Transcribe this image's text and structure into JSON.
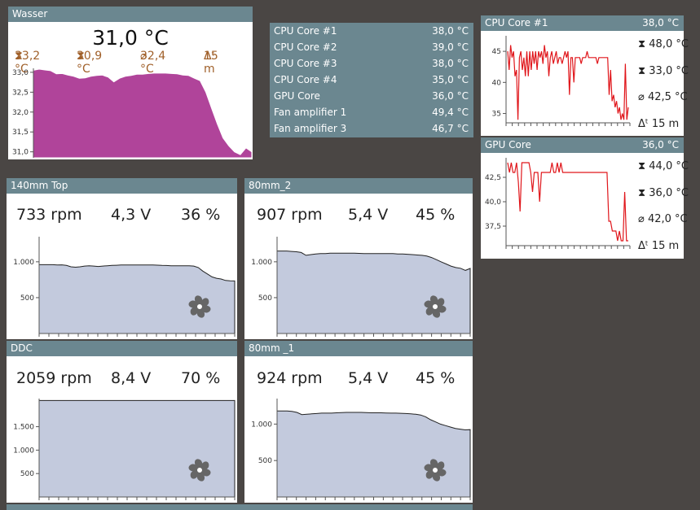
{
  "colors": {
    "header_bg": "#6b8790",
    "water_fill": "#b0449a",
    "fan_fill": "#c3cadd",
    "cpu_line": "#e0161b",
    "stats_accent": "#a0602a"
  },
  "water": {
    "title": "Wasser",
    "value": "31,0 °C",
    "max": "33,2 °C",
    "min": "30,9 °C",
    "avg": "32,4 °C",
    "span": "15 m",
    "y_ticks": [
      "33,0",
      "32,5",
      "32,0",
      "31,5",
      "31,0"
    ],
    "series": [
      33.05,
      33.08,
      33.06,
      33.04,
      32.96,
      32.97,
      32.93,
      32.9,
      32.85,
      32.86,
      32.9,
      32.92,
      32.93,
      32.88,
      32.76,
      32.85,
      32.9,
      32.92,
      32.95,
      32.95,
      32.97,
      32.98,
      32.98,
      32.98,
      32.97,
      32.96,
      32.93,
      32.92,
      32.85,
      32.79,
      32.5,
      32.1,
      31.7,
      31.35,
      31.15,
      31.0,
      30.93,
      31.1,
      31.0
    ]
  },
  "sensors": [
    {
      "name": "CPU Core #1",
      "value": "38,0 °C"
    },
    {
      "name": "CPU Core #2",
      "value": "39,0 °C"
    },
    {
      "name": "CPU Core #3",
      "value": "38,0 °C"
    },
    {
      "name": "CPU Core #4",
      "value": "35,0 °C"
    },
    {
      "name": "GPU Core",
      "value": "36,0 °C"
    },
    {
      "name": "Fan amplifier 1",
      "value": "49,4 °C"
    },
    {
      "name": "Fan amplifier 3",
      "value": "46,7 °C"
    }
  ],
  "cpu_core1": {
    "title": "CPU Core #1",
    "current": "38,0 °C",
    "max": "48,0 °C",
    "min": "33,0 °C",
    "avg": "42,5 °C",
    "span": "15 m",
    "y_ticks": [
      "45",
      "40",
      "35"
    ],
    "series": [
      45,
      42,
      46,
      44,
      45,
      41,
      42,
      34,
      44,
      45,
      42,
      44,
      41,
      45,
      41,
      45,
      42,
      45,
      43,
      45,
      42,
      45,
      44,
      45,
      43,
      46,
      44,
      45,
      41,
      44,
      45,
      43,
      44,
      45,
      43,
      44,
      44,
      43,
      44,
      45,
      44,
      45,
      38,
      44,
      44,
      40,
      44,
      44,
      44,
      44,
      43,
      44,
      44,
      44,
      45,
      44,
      44,
      44,
      44,
      44,
      44,
      43,
      44,
      44,
      44,
      44,
      44,
      44,
      44,
      38,
      42,
      37,
      38,
      36,
      37,
      35,
      36,
      34,
      35,
      34,
      43,
      34,
      36
    ]
  },
  "gpu_core": {
    "title": "GPU Core",
    "current": "36,0 °C",
    "max": "44,0 °C",
    "min": "36,0 °C",
    "avg": "42,0 °C",
    "span": "15 m",
    "y_ticks": [
      "42,5",
      "40,0",
      "37,5"
    ],
    "series": [
      44,
      43,
      44,
      43,
      43,
      44,
      42,
      39,
      44,
      44,
      44,
      44,
      44,
      43,
      41,
      43,
      43,
      43,
      40,
      43,
      43,
      43,
      43,
      43,
      43,
      44,
      43,
      43,
      44,
      43,
      44,
      43,
      43,
      43,
      43,
      43,
      43,
      43,
      43,
      43,
      43,
      43,
      43,
      43,
      43,
      43,
      43,
      43,
      43,
      43,
      43,
      43,
      43,
      43,
      43,
      43,
      43,
      38,
      38,
      37,
      37,
      37,
      36,
      37,
      36,
      36,
      41,
      36,
      36
    ]
  },
  "fans": [
    {
      "title": "140mm Top",
      "rpm": "733 rpm",
      "volt": "4,3 V",
      "pct": "36 %",
      "y_ticks": [
        {
          "label": "1.000",
          "v": 1000
        },
        {
          "label": "500",
          "v": 500
        }
      ],
      "ymax": 1350,
      "series": [
        960,
        960,
        960,
        960,
        955,
        958,
        950,
        930,
        925,
        930,
        940,
        945,
        940,
        935,
        940,
        945,
        950,
        952,
        955,
        955,
        955,
        955,
        955,
        955,
        955,
        955,
        953,
        950,
        948,
        945,
        945,
        945,
        945,
        945,
        940,
        920,
        870,
        830,
        790,
        770,
        760,
        740,
        735,
        733
      ]
    },
    {
      "title": "80mm_2",
      "rpm": "907 rpm",
      "volt": "5,4 V",
      "pct": "45 %",
      "y_ticks": [
        {
          "label": "1.000",
          "v": 1000
        },
        {
          "label": "500",
          "v": 500
        }
      ],
      "ymax": 1350,
      "series": [
        1150,
        1150,
        1150,
        1145,
        1140,
        1130,
        1090,
        1100,
        1110,
        1115,
        1115,
        1120,
        1120,
        1120,
        1120,
        1120,
        1120,
        1118,
        1115,
        1115,
        1115,
        1115,
        1115,
        1115,
        1115,
        1110,
        1110,
        1105,
        1100,
        1095,
        1090,
        1080,
        1060,
        1030,
        1000,
        970,
        940,
        920,
        910,
        880,
        907
      ]
    },
    {
      "title": "DDC",
      "rpm": "2059 rpm",
      "volt": "8,4 V",
      "pct": "70 %",
      "y_ticks": [
        {
          "label": "1.500",
          "v": 1500
        },
        {
          "label": "1.000",
          "v": 1000
        },
        {
          "label": "500",
          "v": 500
        }
      ],
      "ymax": 2100,
      "series": [
        2059,
        2059,
        2059,
        2059,
        2059,
        2059,
        2059,
        2059,
        2059,
        2059,
        2059,
        2059,
        2059,
        2059,
        2059,
        2059,
        2059,
        2059,
        2059,
        2059,
        2059,
        2059,
        2059,
        2059,
        2059,
        2059,
        2059,
        2059,
        2059,
        2059
      ]
    },
    {
      "title": "80mm _1",
      "rpm": "924 rpm",
      "volt": "5,4 V",
      "pct": "45 %",
      "y_ticks": [
        {
          "label": "1.000",
          "v": 1000
        },
        {
          "label": "500",
          "v": 500
        }
      ],
      "ymax": 1350,
      "series": [
        1180,
        1180,
        1180,
        1175,
        1160,
        1130,
        1135,
        1140,
        1145,
        1150,
        1150,
        1150,
        1155,
        1158,
        1160,
        1160,
        1160,
        1160,
        1158,
        1155,
        1155,
        1155,
        1152,
        1150,
        1150,
        1148,
        1145,
        1140,
        1135,
        1125,
        1100,
        1060,
        1030,
        1000,
        980,
        960,
        940,
        930,
        920,
        924
      ]
    }
  ]
}
